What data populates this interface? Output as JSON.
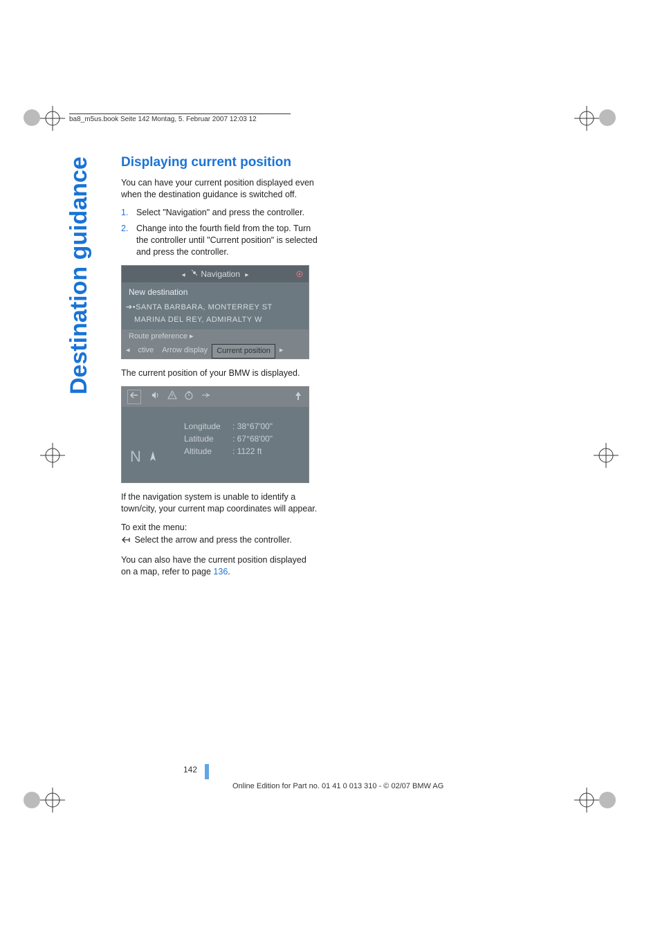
{
  "header_line": "ba8_m5us.book  Seite 142  Montag, 5. Februar 2007  12:03 12",
  "side_title": "Destination guidance",
  "heading": "Displaying current position",
  "intro": "You can have your current position displayed even when the destination guidance is switched off.",
  "steps": [
    "Select \"Navigation\" and press the controller.",
    "Change into the fourth field from the top. Turn the controller until \"Current position\" is selected and press the controller."
  ],
  "nav_screen": {
    "title": "Navigation",
    "new_destination": "New destination",
    "line1": "SANTA BARBARA, MONTERREY ST",
    "line2": "MARINA DEL REY, ADMIRALTY W",
    "route_preference": "Route preference ▸",
    "tab1": "ctive",
    "tab2": "Arrow display",
    "tab3": "Current position"
  },
  "after_nav": "The current position of your BMW is displayed.",
  "pos_screen": {
    "na": "N",
    "longitude_label": "Longitude",
    "longitude_value": ": 38°67'00\"",
    "latitude_label": "Latitude",
    "latitude_value": ": 67°68'00\"",
    "altitude_label": "Altitude",
    "altitude_value": ": 1122 ft"
  },
  "para_unable": "If the navigation system is unable to identify a town/city, your current map coordinates will appear.",
  "exit_label": "To exit the menu:",
  "exit_instruction": " Select the arrow and press the controller.",
  "map_ref_pre": "You can also have the current position displayed on a map, refer to page ",
  "map_ref_page": "136",
  "map_ref_post": ".",
  "page_number": "142",
  "footer": "Online Edition for Part no. 01 41 0 013 310 - © 02/07 BMW AG"
}
